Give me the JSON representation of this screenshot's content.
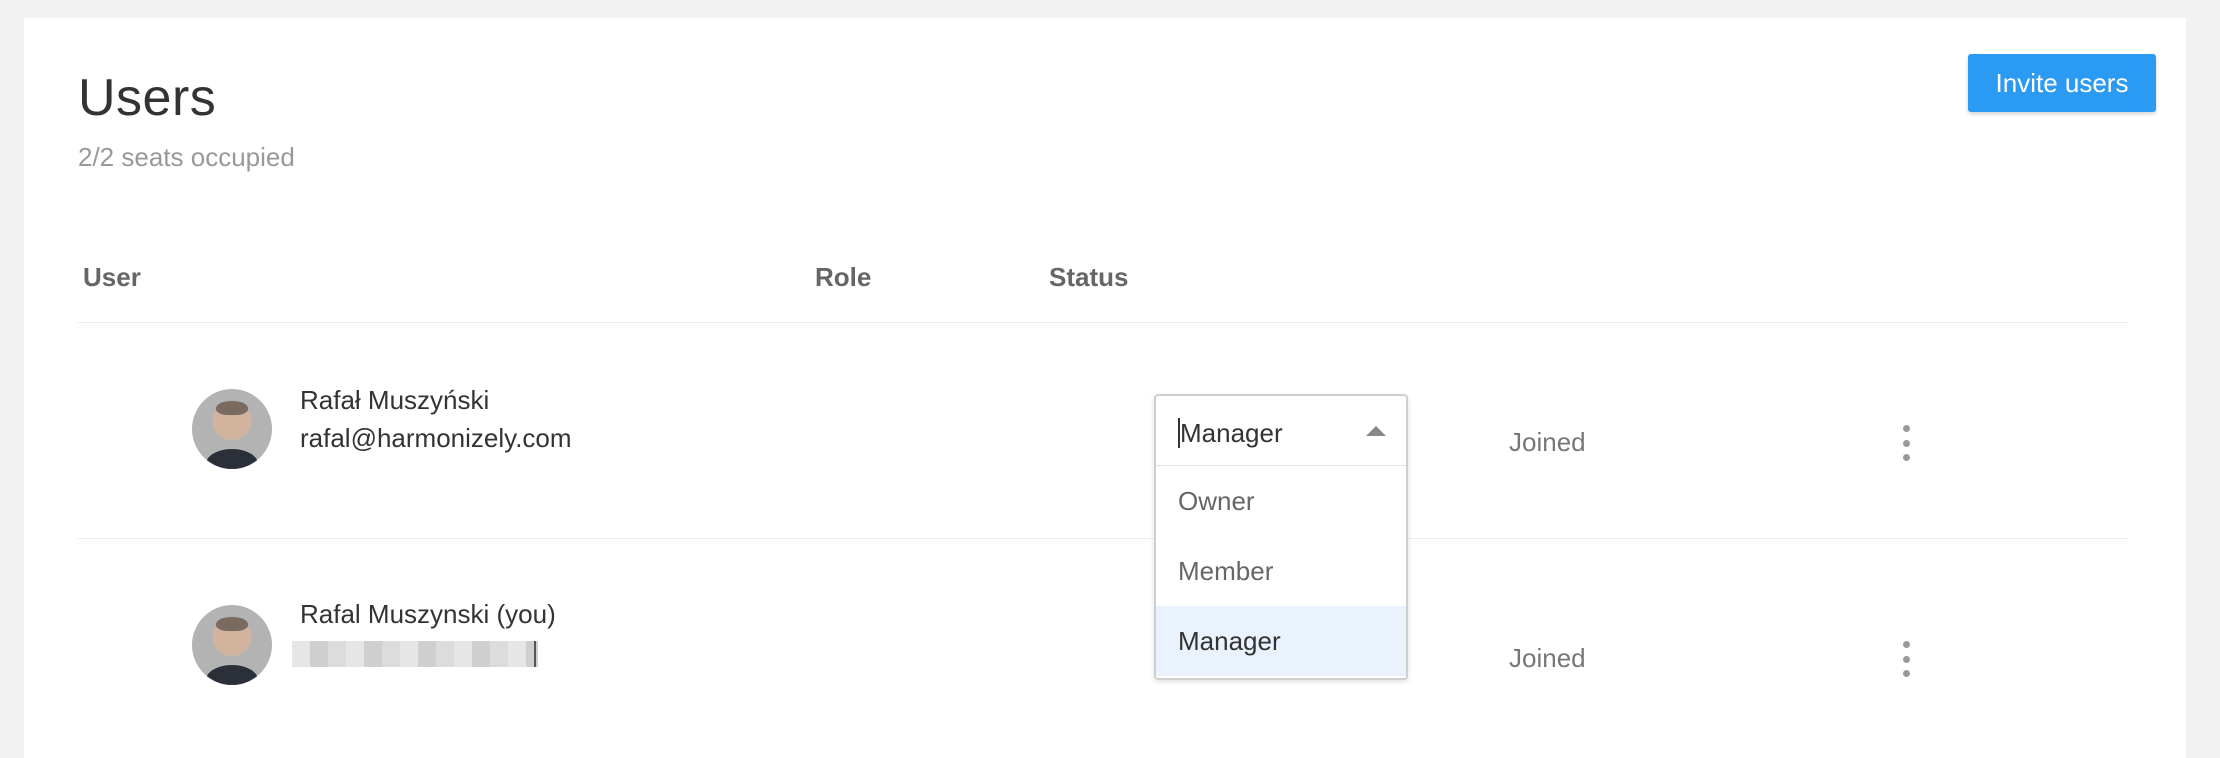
{
  "page": {
    "title": "Users",
    "seats": "2/2 seats occupied",
    "invite_label": "Invite users"
  },
  "table": {
    "columns": [
      "User",
      "Role",
      "Status"
    ],
    "rows": [
      {
        "name": "Rafał Muszyński",
        "email": "rafal@harmonizely.com",
        "status": "Joined"
      },
      {
        "name": "Rafal Muszynski (you)",
        "email": "",
        "status": "Joined"
      }
    ]
  },
  "role_dropdown": {
    "selected": "Manager",
    "options": [
      "Owner",
      "Member",
      "Manager"
    ]
  },
  "colors": {
    "accent": "#2b9af3",
    "selected_option_bg": "#eaf2fd"
  }
}
